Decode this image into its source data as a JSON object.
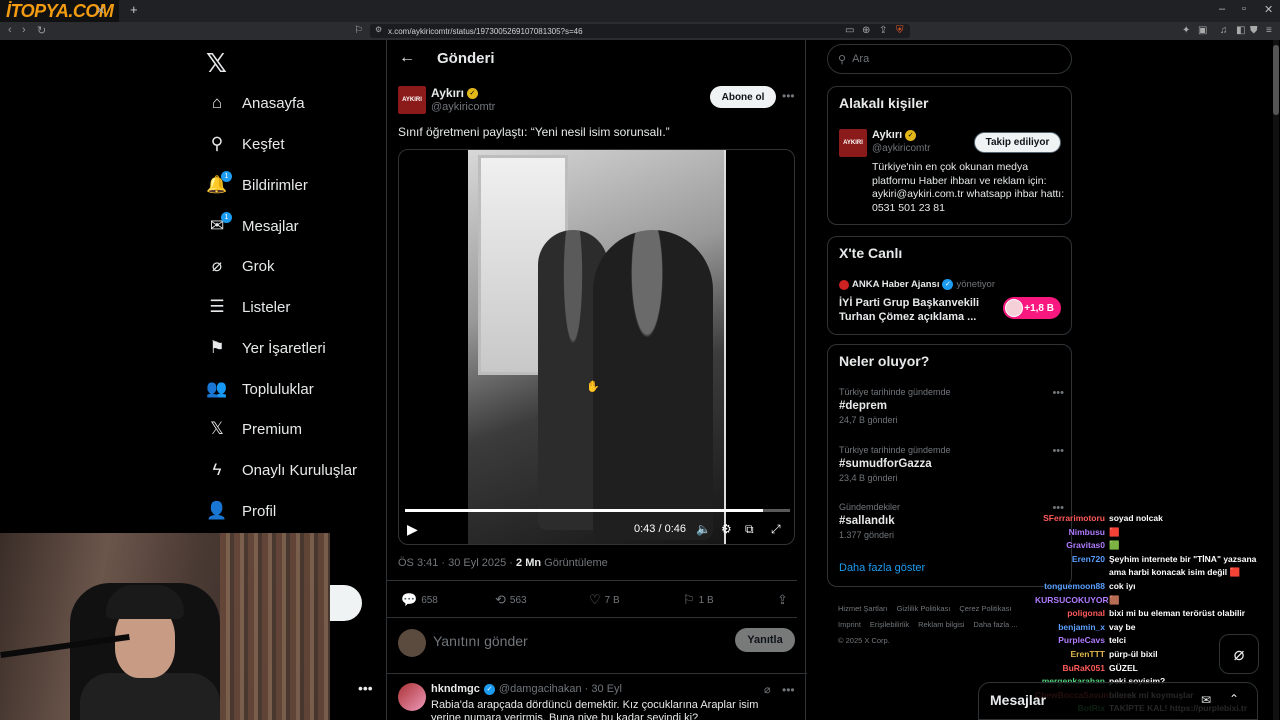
{
  "browser": {
    "logo": "İTOPYA.COM",
    "url": "x.com/aykiricomtr/status/1973005269107081305?s=46"
  },
  "nav": {
    "items": [
      {
        "label": "Anasayfa",
        "icon": "home-icon",
        "glyph": "⌂"
      },
      {
        "label": "Keşfet",
        "icon": "search-icon",
        "glyph": "⚲"
      },
      {
        "label": "Bildirimler",
        "icon": "bell-icon",
        "glyph": "🔔",
        "badge": "1"
      },
      {
        "label": "Mesajlar",
        "icon": "mail-icon",
        "glyph": "✉",
        "badge": "1"
      },
      {
        "label": "Grok",
        "icon": "grok-icon",
        "glyph": "⌀"
      },
      {
        "label": "Listeler",
        "icon": "list-icon",
        "glyph": "☰"
      },
      {
        "label": "Yer İşaretleri",
        "icon": "bookmark-icon",
        "glyph": "⚑"
      },
      {
        "label": "Topluluklar",
        "icon": "communities-icon",
        "glyph": "👥"
      },
      {
        "label": "Premium",
        "icon": "x-icon",
        "glyph": "𝕏"
      },
      {
        "label": "Onaylı Kuruluşlar",
        "icon": "lightning-icon",
        "glyph": "ϟ"
      },
      {
        "label": "Profil",
        "icon": "profile-icon",
        "glyph": "👤"
      }
    ]
  },
  "header": {
    "title": "Gönderi"
  },
  "post": {
    "author_name": "Aykırı",
    "author_handle": "@aykiricomtr",
    "avatar_text": "AYKIRI",
    "follow_label": "Abone ol",
    "text": "Sınıf öğretmeni paylaştı: “Yeni nesil isim sorunsalı.”",
    "video_time": "0:43 / 0:46",
    "video_progress": 0.93,
    "timestamp": "ÖS 3:41 · 30 Eyl 2025 · ",
    "views": "2 Mn",
    "views_label": "Görüntüleme",
    "replies": "658",
    "reposts": "563",
    "likes": "7 B",
    "bookmarks": "1 B"
  },
  "reply": {
    "placeholder": "Yanıtını gönder",
    "button": "Yanıtla"
  },
  "comment": {
    "name": "hkndmgc",
    "handle": "@damgacihakan · 30 Eyl",
    "text": "Rabia'da arapçada dördüncü demektir. Kız çocuklarına Araplar isim yerine numara verirmiş. Buna niye bu kadar sevindi ki?"
  },
  "search": {
    "placeholder": "Ara"
  },
  "related": {
    "title": "Alakalı kişiler",
    "name": "Aykırı",
    "handle": "@aykiricomtr",
    "button": "Takip ediliyor",
    "bio": "Türkiye'nin en çok okunan medya platformu Haber ihbarı ve reklam için: aykiri@aykiri.com.tr whatsapp ihbar hattı: 0531 501 23 81"
  },
  "live": {
    "title": "X'te Canlı",
    "host": "ANKA Haber Ajansı",
    "host_suffix": "yönetiyor",
    "headline": "İYİ Parti Grup Başkanvekili Turhan Çömez açıklama ...",
    "listeners": "+1,8 B"
  },
  "trends": {
    "title": "Neler oluyor?",
    "items": [
      {
        "context": "Türkiye tarihinde gündemde",
        "tag": "#deprem",
        "count": "24,7 B gönderi"
      },
      {
        "context": "Türkiye tarihinde gündemde",
        "tag": "#sumudforGazza",
        "count": "23,4 B gönderi"
      },
      {
        "context": "Gündemdekiler",
        "tag": "#sallandık",
        "count": "1.377 gönderi"
      }
    ],
    "show_more": "Daha fazla göster"
  },
  "footer": {
    "links": [
      "Hizmet Şartları",
      "Gizlilik Politikası",
      "Çerez Politikası",
      "Imprint",
      "Erişilebilirlik",
      "Reklam bilgisi",
      "Daha fazla ..."
    ],
    "copyright": "© 2025 X Corp."
  },
  "chat": [
    {
      "user": "SFerrarimotoru",
      "msg": "soyad nolcak",
      "color": "#ff5a5a"
    },
    {
      "user": "Nimbusu",
      "msg": "🟥",
      "color": "#b07bff"
    },
    {
      "user": "Gravitas0",
      "msg": "🟩",
      "color": "#b07bff"
    },
    {
      "user": "Eren720",
      "msg": "Şeyhim internete bir \"TİNA\" yazsana",
      "color": "#5aa0ff"
    },
    {
      "user": "",
      "msg": "ama harbi konacak isim değil 🟥",
      "color": "#ffffff"
    },
    {
      "user": "tonguemoon88",
      "msg": "cok iyı",
      "color": "#5aa0ff"
    },
    {
      "user": "KURSUCOKUYOR",
      "msg": "🟫",
      "color": "#b07bff"
    },
    {
      "user": "poligonal",
      "msg": "bixi mi bu eleman terörüst olabilir",
      "color": "#ff5a5a"
    },
    {
      "user": "benjamin_x",
      "msg": "vay be",
      "color": "#5aa0ff"
    },
    {
      "user": "PurpleCavs",
      "msg": "telci",
      "color": "#b07bff"
    },
    {
      "user": "ErenTTT",
      "msg": "pürp-ül bixil",
      "color": "#e0b84a"
    },
    {
      "user": "BuRaK051",
      "msg": "GÜZEL",
      "color": "#ff5a5a"
    },
    {
      "user": "mergenkarahan",
      "msg": "peki soyisim?",
      "color": "#4fd17a"
    },
    {
      "user": "ChewBoccaSavunucusu",
      "msg": "bilerek mi koymuşlar",
      "color": "#ff5a5a"
    },
    {
      "user": "BotRix",
      "msg": "TAKİPTE KAL! https://purplebixi.tr",
      "color": "#4fd17a"
    }
  ],
  "messages_bar": {
    "label": "Mesajlar"
  },
  "colors": {
    "accent": "#1d9bf0",
    "background": "#000000",
    "border": "#2f3336",
    "muted": "#71767b"
  }
}
